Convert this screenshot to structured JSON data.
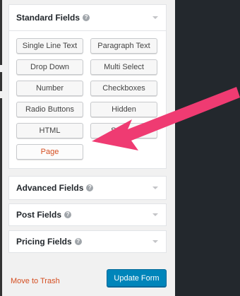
{
  "standard_fields": {
    "title": "Standard Fields",
    "help_icon": "question-circle-icon",
    "buttons": [
      "Single Line Text",
      "Paragraph Text",
      "Drop Down",
      "Multi Select",
      "Number",
      "Checkboxes",
      "Radio Buttons",
      "Hidden",
      "HTML",
      "Section",
      "Page"
    ]
  },
  "advanced_fields": {
    "title": "Advanced Fields"
  },
  "post_fields": {
    "title": "Post Fields"
  },
  "pricing_fields": {
    "title": "Pricing Fields"
  },
  "footer": {
    "trash_label": "Move to Trash",
    "update_label": "Update Form"
  },
  "colors": {
    "accent_blue": "#0085ba",
    "danger_red": "#d54e21",
    "annotation_pink": "#ef3b72"
  }
}
